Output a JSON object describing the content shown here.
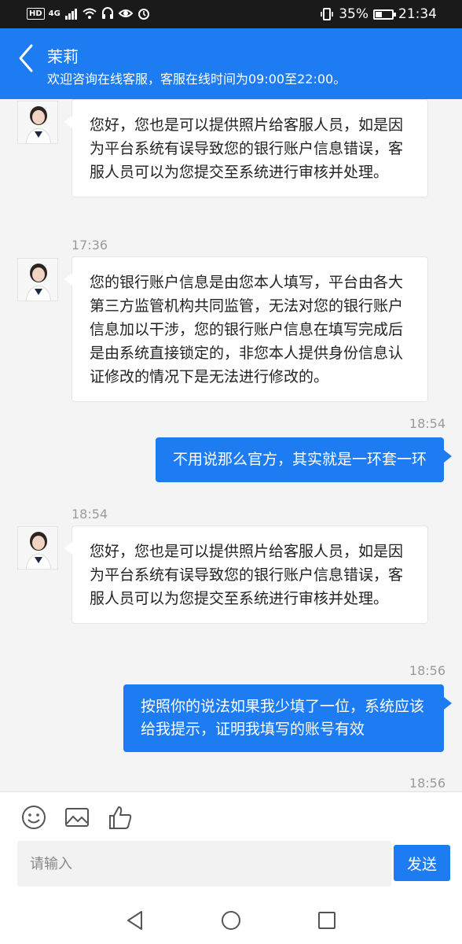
{
  "status_bar": {
    "hd": "HD",
    "network": "4G",
    "battery_percent": "35%",
    "battery_level": 0.35,
    "time": "21:34"
  },
  "header": {
    "title": "茉莉",
    "subtitle": "欢迎咨询在线客服，客服在线时间为09:00至22:00。"
  },
  "messages": [
    {
      "type": "in",
      "text": "您好，您也是可以提供照片给客服人员，如是因为平台系统有误导致您的银行账户信息错误，客服人员可以为您提交至系统进行审核并处理。"
    },
    {
      "type": "time",
      "text": "17:36"
    },
    {
      "type": "in",
      "text": "您的银行账户信息是由您本人填写，平台由各大第三方监管机构共同监管，无法对您的银行账户信息加以干涉，您的银行账户信息在填写完成后是由系统直接锁定的，非您本人提供身份信息认证修改的情况下是无法进行修改的。"
    },
    {
      "type": "time",
      "text": "18:54"
    },
    {
      "type": "out",
      "text": "不用说那么官方，其实就是一环套一环"
    },
    {
      "type": "time",
      "text": "18:54"
    },
    {
      "type": "in",
      "text": "您好，您也是可以提供照片给客服人员，如是因为平台系统有误导致您的银行账户信息错误，客服人员可以为您提交至系统进行审核并处理。"
    },
    {
      "type": "time",
      "text": "18:56"
    },
    {
      "type": "out",
      "text": "按照你的说法如果我少填了一位，系统应该给我提示，证明我填写的账号有效"
    },
    {
      "type": "time",
      "text": "18:56"
    }
  ],
  "input": {
    "placeholder": "请输入",
    "send_label": "发送"
  },
  "icons": {
    "back": "back-icon",
    "emoji": "emoji-icon",
    "image": "image-icon",
    "like": "thumbs-up-icon"
  },
  "colors": {
    "accent": "#1e7cf2",
    "status_bar": "#1a1a1a",
    "chat_bg": "#f4f4f4"
  }
}
